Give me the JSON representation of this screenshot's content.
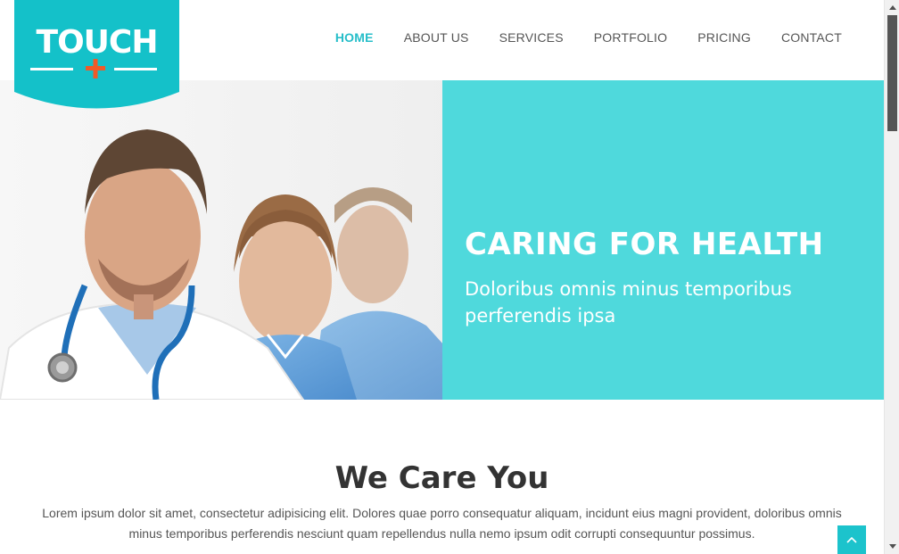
{
  "brand": {
    "logo_text": "TOUCH",
    "colors": {
      "teal": "#26bec9",
      "panel": "#4fd9dc",
      "cross": "#f05a28"
    }
  },
  "nav": {
    "items": [
      {
        "label": "HOME",
        "active": true
      },
      {
        "label": "ABOUT US",
        "active": false
      },
      {
        "label": "SERVICES",
        "active": false
      },
      {
        "label": "PORTFOLIO",
        "active": false
      },
      {
        "label": "PRICING",
        "active": false
      },
      {
        "label": "CONTACT",
        "active": false
      }
    ]
  },
  "hero": {
    "title": "CARING FOR HEALTH",
    "subtitle": "Doloribus omnis minus temporibus perferendis ipsa"
  },
  "about": {
    "title": "We Care You",
    "text": "Lorem ipsum dolor sit amet, consectetur adipisicing elit. Dolores quae porro consequatur aliquam, incidunt eius magni provident, doloribus omnis minus temporibus perferendis nesciunt quam repellendus nulla nemo ipsum odit corrupti consequuntur possimus."
  },
  "icons": {
    "back_to_top": "chevron-up-icon",
    "logo_cross": "plus-icon"
  }
}
